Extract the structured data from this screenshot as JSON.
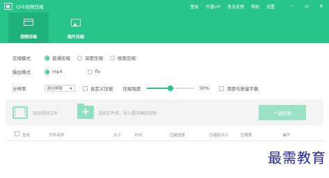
{
  "app": {
    "title": "QVE视频压缩"
  },
  "top_menu": [
    "登录",
    "开通VIP",
    "意见反馈",
    "帮助",
    "设置"
  ],
  "window_controls": [
    "–",
    "▫",
    "×"
  ],
  "tabs": [
    {
      "label": "视频压缩",
      "icon": "video-icon",
      "active": true
    },
    {
      "label": "图片压缩",
      "icon": "image-icon",
      "active": false
    }
  ],
  "compress_mode": {
    "label": "压缩模式",
    "options": [
      "普通压缩",
      "深度压缩",
      "极限压缩"
    ],
    "selected": 0
  },
  "output_format": {
    "label": "输出格式",
    "options": [
      "mp4",
      "flv"
    ],
    "selected": 0
  },
  "resolution": {
    "label": "分辨率",
    "value": "原分辨率",
    "custom_label": "自定义压缩",
    "strength_label": "压缩强度",
    "strength_value": "50%",
    "strength_fraction": 0.5,
    "balance_label": "清度与质量平衡"
  },
  "toolbar": {
    "add_file": "添加视频文件",
    "select_folder": "选择文件夹，导入要压缩的视频",
    "compress_button": "一键压缩"
  },
  "table": {
    "select_all": "全选",
    "columns": [
      "文件名称",
      "大小",
      "时长",
      "压缩进度",
      "压缩后大小",
      "压缩率",
      "操作"
    ]
  },
  "watermark": "最需教育",
  "colors": {
    "accent": "#27c58a",
    "accent_dark": "#1fb27b",
    "button_light": "#9be3c7"
  }
}
